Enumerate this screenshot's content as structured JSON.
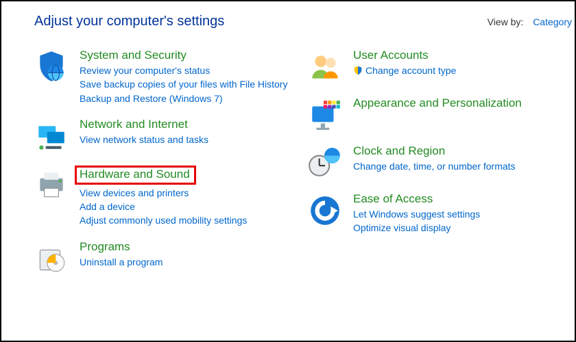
{
  "header": {
    "title": "Adjust your computer's settings",
    "viewby_label": "View by:",
    "viewby_value": "Category"
  },
  "left": [
    {
      "icon": "shield-globe",
      "title": "System and Security",
      "links": [
        "Review your computer's status",
        "Save backup copies of your files with File History",
        "Backup and Restore (Windows 7)"
      ]
    },
    {
      "icon": "network",
      "title": "Network and Internet",
      "links": [
        "View network status and tasks"
      ]
    },
    {
      "icon": "printer",
      "title": "Hardware and Sound",
      "highlighted": true,
      "links": [
        "View devices and printers",
        "Add a device",
        "Adjust commonly used mobility settings"
      ]
    },
    {
      "icon": "programs",
      "title": "Programs",
      "links": [
        "Uninstall a program"
      ]
    }
  ],
  "right": [
    {
      "icon": "users",
      "title": "User Accounts",
      "links": [
        {
          "text": "Change account type",
          "shield": true
        }
      ]
    },
    {
      "icon": "appearance",
      "title": "Appearance and Personalization",
      "links": []
    },
    {
      "icon": "clock",
      "title": "Clock and Region",
      "links": [
        "Change date, time, or number formats"
      ]
    },
    {
      "icon": "ease",
      "title": "Ease of Access",
      "links": [
        "Let Windows suggest settings",
        "Optimize visual display"
      ]
    }
  ]
}
